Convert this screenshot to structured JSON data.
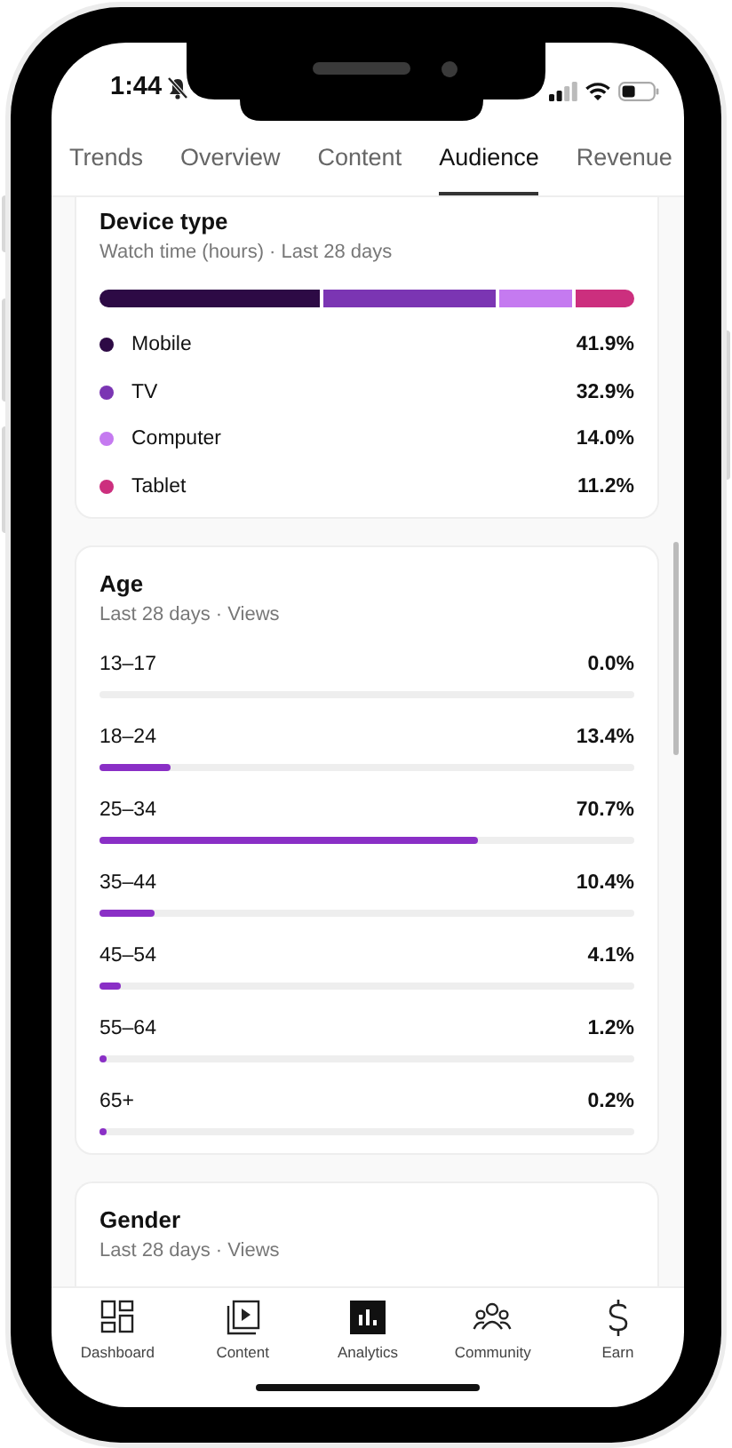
{
  "status_bar": {
    "time": "1:44"
  },
  "tabs": [
    {
      "label": "Trends",
      "selected": false
    },
    {
      "label": "Overview",
      "selected": false
    },
    {
      "label": "Content",
      "selected": false
    },
    {
      "label": "Audience",
      "selected": true
    },
    {
      "label": "Revenue",
      "selected": false
    }
  ],
  "device_type": {
    "title": "Device type",
    "subtitle": "Watch time (hours) · Last 28 days",
    "items": [
      {
        "label": "Mobile",
        "value": "41.9%",
        "color": "#2d0a45"
      },
      {
        "label": "TV",
        "value": "32.9%",
        "color": "#7b35b3"
      },
      {
        "label": "Computer",
        "value": "14.0%",
        "color": "#c57af0"
      },
      {
        "label": "Tablet",
        "value": "11.2%",
        "color": "#cc2f7e"
      }
    ]
  },
  "age": {
    "title": "Age",
    "subtitle": "Last 28 days · Views",
    "rows": [
      {
        "label": "13–17",
        "value": "0.0%"
      },
      {
        "label": "18–24",
        "value": "13.4%",
        "level": 0.134
      },
      {
        "label": "25–34",
        "value": "70.7%",
        "level": 0.707
      },
      {
        "label": "35–44",
        "value": "10.4%",
        "level": 0.104
      },
      {
        "label": "45–54",
        "value": "4.1%",
        "level": 0.041
      },
      {
        "label": "55–64",
        "value": "1.2%",
        "level": 0.012
      },
      {
        "label": "65+",
        "value": "0.2%",
        "level": 0.002
      }
    ]
  },
  "gender": {
    "title": "Gender",
    "subtitle": "Last 28 days · Views"
  },
  "bottom_nav": [
    {
      "label": "Dashboard",
      "selected": false
    },
    {
      "label": "Content",
      "selected": false
    },
    {
      "label": "Analytics",
      "selected": true
    },
    {
      "label": "Community",
      "selected": false
    },
    {
      "label": "Earn",
      "selected": false
    }
  ]
}
